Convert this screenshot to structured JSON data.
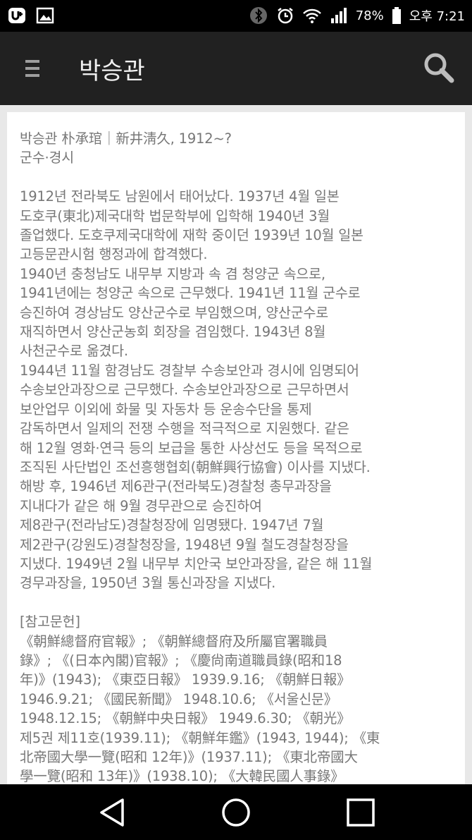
{
  "status_bar": {
    "battery_percent": "78%",
    "time": "오후 7:21"
  },
  "toolbar": {
    "title": "박승관"
  },
  "article": {
    "header_line1": "박승관 朴承琯｜新井淸久, 1912~?",
    "header_line2": "군수·경시",
    "body": "1912년 전라북도 남원에서 태어났다. 1937년 4월 일본\n도호쿠(東北)제국대학 법문학부에 입학해 1940년 3월\n졸업했다. 도호쿠제국대학에 재학 중이던 1939년 10월 일본\n고등문관시험 행정과에 합격했다.\n1940년 충청남도 내무부 지방과 속 겸 청양군 속으로,\n1941년에는 청양군 속으로 근무했다. 1941년 11월 군수로\n승진하여 경상남도 양산군수로 부임했으며, 양산군수로\n재직하면서 양산군농회 회장을 겸임했다. 1943년 8월\n사천군수로 옮겼다.\n1944년 11월 함경남도 경찰부 수송보안과 경시에 임명되어\n수송보안과장으로 근무했다. 수송보안과장으로 근무하면서\n보안업무 이외에 화물 및 자동차 등 운송수단을 통제\n감독하면서 일제의 전쟁 수행을 적극적으로 지원했다. 같은\n해 12월 영화·연극 등의 보급을 통한 사상선도 등을 목적으로\n조직된 사단법인 조선흥행협회(朝鮮興行協會) 이사를 지냈다.\n해방 후, 1946년 제6관구(전라북도)경찰청 총무과장을\n지내다가 같은 해 9월 경무관으로 승진하여\n제8관구(전라남도)경찰청장에 임명됐다. 1947년 7월\n제2관구(강원도)경찰청장을, 1948년 9월 철도경찰청장을\n지냈다. 1949년 2월 내무부 치안국 보안과장을, 같은 해 11월\n경무과장을, 1950년 3월 통신과장을 지냈다.",
    "refs_heading": "[참고문헌]",
    "refs": "《朝鮮總督府官報》; 《朝鮮總督府及所屬官署職員\n錄》; 《(日本內閣)官報》; 《慶尙南道職員錄(昭和18\n年)》(1943); 《東亞日報》 1939.9.16; 《朝鮮日報》\n1946.9.21; 《國民新聞》 1948.10.6; 《서울신문》\n1948.12.15; 《朝鮮中央日報》 1949.6.30; 《朝光》\n제5권 제11호(1939.11); 《朝鮮年鑑》(1943, 1944); 《東\n北帝國大學一覽(昭和 12年)》(1937.11); 《東北帝國大\n學一覽(昭和 13年)》(1938.10); 《大韓民國人事錄》"
  },
  "colors": {
    "toolbar_bg": "#212121",
    "text": "#777777",
    "background": "#e8e8e8"
  }
}
